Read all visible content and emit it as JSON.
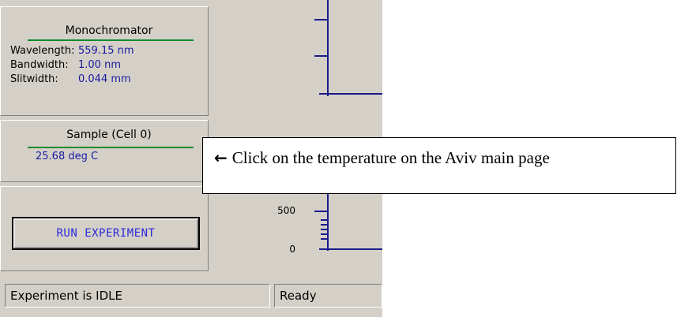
{
  "monochromator": {
    "title": "Monochromator",
    "wavelength_label": "Wavelength:",
    "wavelength_value": "559.15 nm",
    "bandwidth_label": "Bandwidth:",
    "bandwidth_value": "1.00 nm",
    "slitwidth_label": "Slitwidth:",
    "slitwidth_value": "0.044 mm"
  },
  "sample": {
    "title": "Sample (Cell 0)",
    "temperature": "25.68 deg C"
  },
  "run_button": {
    "label": "RUN EXPERIMENT"
  },
  "plot": {
    "tick_500": "500",
    "tick_0": "0",
    "axis_color": "#1a1a8c"
  },
  "status": {
    "experiment": "Experiment is IDLE",
    "state": "Ready"
  },
  "callout": {
    "text": "Click on the temperature on the Aviv main page",
    "arrow_icon": "left-arrow"
  },
  "colors": {
    "accent_green": "#0f8a2e",
    "value_blue": "#1a1aa0",
    "button_text": "#2a2ad8",
    "window_bg": "#d4d0c8"
  }
}
